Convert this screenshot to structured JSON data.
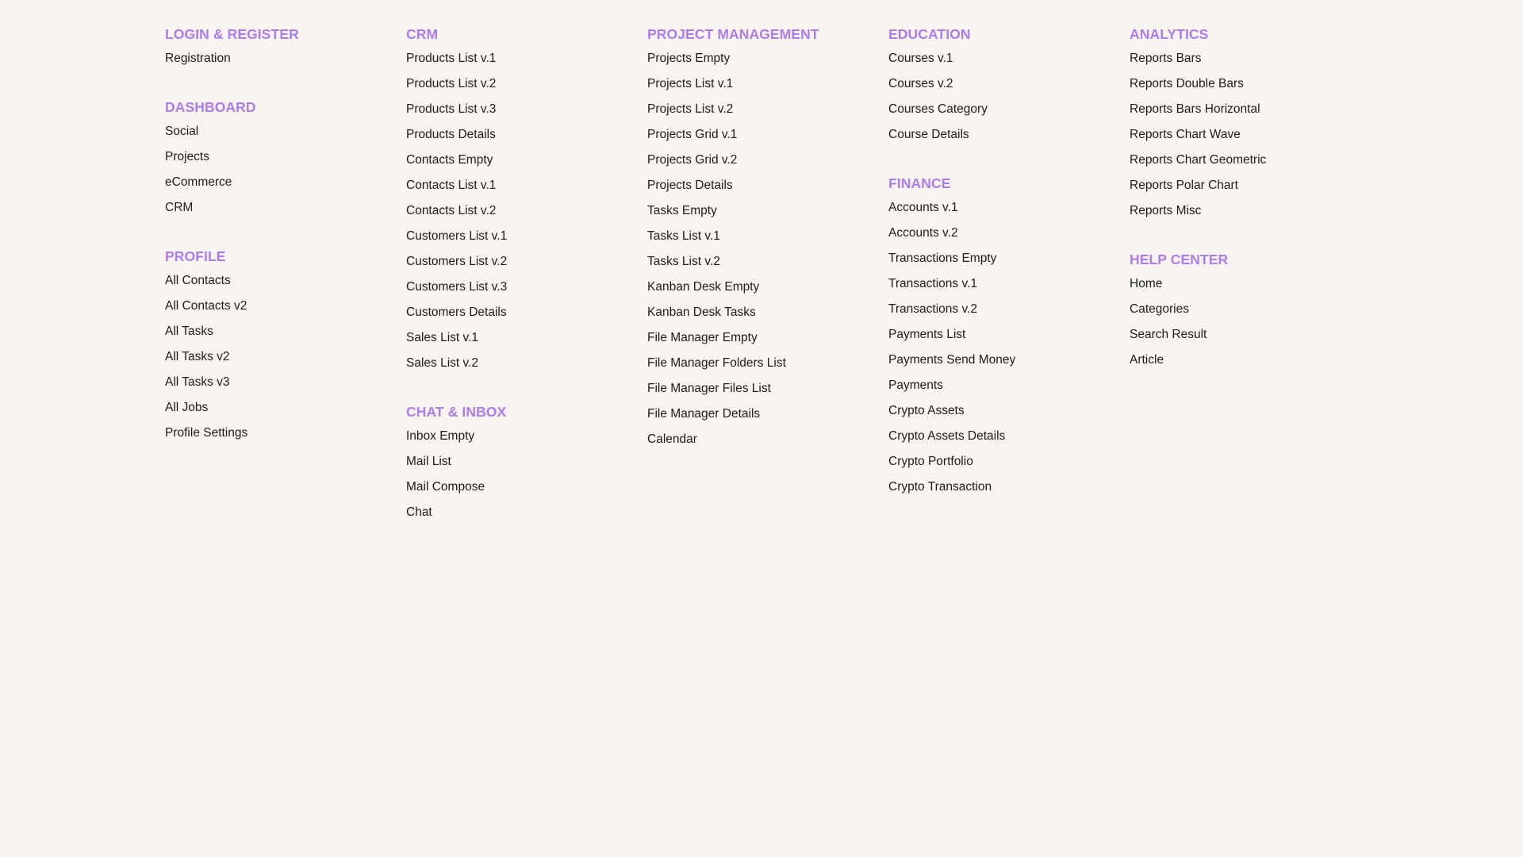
{
  "columns": [
    {
      "sections": [
        {
          "title": "LOGIN & REGISTER",
          "items": [
            "Registration"
          ]
        },
        {
          "title": "DASHBOARD",
          "items": [
            "Social",
            "Projects",
            "eCommerce",
            "CRM"
          ]
        },
        {
          "title": "PROFILE",
          "items": [
            "All Contacts",
            "All Contacts v2",
            "All Tasks",
            "All Tasks v2",
            "All Tasks v3",
            "All Jobs",
            "Profile Settings"
          ]
        }
      ]
    },
    {
      "sections": [
        {
          "title": "CRM",
          "items": [
            "Products List v.1",
            "Products List v.2",
            "Products List v.3",
            "Products Details",
            "Contacts Empty",
            "Contacts List v.1",
            "Contacts List v.2",
            "Customers List v.1",
            "Customers List v.2",
            "Customers List v.3",
            "Customers Details",
            "Sales List v.1",
            "Sales List v.2"
          ]
        },
        {
          "title": "CHAT & INBOX",
          "items": [
            "Inbox Empty",
            "Mail List",
            "Mail Compose",
            "Chat"
          ]
        }
      ]
    },
    {
      "sections": [
        {
          "title": "PROJECT MANAGEMENT",
          "items": [
            "Projects Empty",
            "Projects List v.1",
            "Projects List v.2",
            "Projects Grid v.1",
            "Projects Grid v.2",
            "Projects Details",
            "Tasks Empty",
            "Tasks List v.1",
            "Tasks List v.2",
            "Kanban Desk Empty",
            "Kanban Desk Tasks",
            "File Manager Empty",
            "File Manager Folders List",
            "File Manager Files List",
            "File Manager Details",
            "Calendar"
          ]
        }
      ]
    },
    {
      "sections": [
        {
          "title": "EDUCATION",
          "items": [
            "Courses v.1",
            "Courses v.2",
            "Courses Category",
            "Course Details"
          ]
        },
        {
          "title": "FINANCE",
          "items": [
            "Accounts v.1",
            "Accounts v.2",
            "Transactions Empty",
            "Transactions v.1",
            "Transactions v.2",
            "Payments List",
            "Payments Send Money",
            "Payments",
            "Crypto Assets",
            "Crypto Assets Details",
            "Crypto Portfolio",
            "Crypto Transaction"
          ]
        }
      ]
    },
    {
      "sections": [
        {
          "title": "ANALYTICS",
          "items": [
            "Reports Bars",
            "Reports Double Bars",
            "Reports Bars Horizontal",
            "Reports Chart Wave",
            "Reports Chart Geometric",
            "Reports Polar Chart",
            "Reports Misc"
          ]
        },
        {
          "title": "HELP CENTER",
          "items": [
            "Home",
            "Categories",
            "Search Result",
            "Article"
          ]
        }
      ]
    }
  ],
  "colors": {
    "background": "#f8f4f0",
    "section_title": "#ad7bef",
    "link_text": "#1c1c1c"
  }
}
